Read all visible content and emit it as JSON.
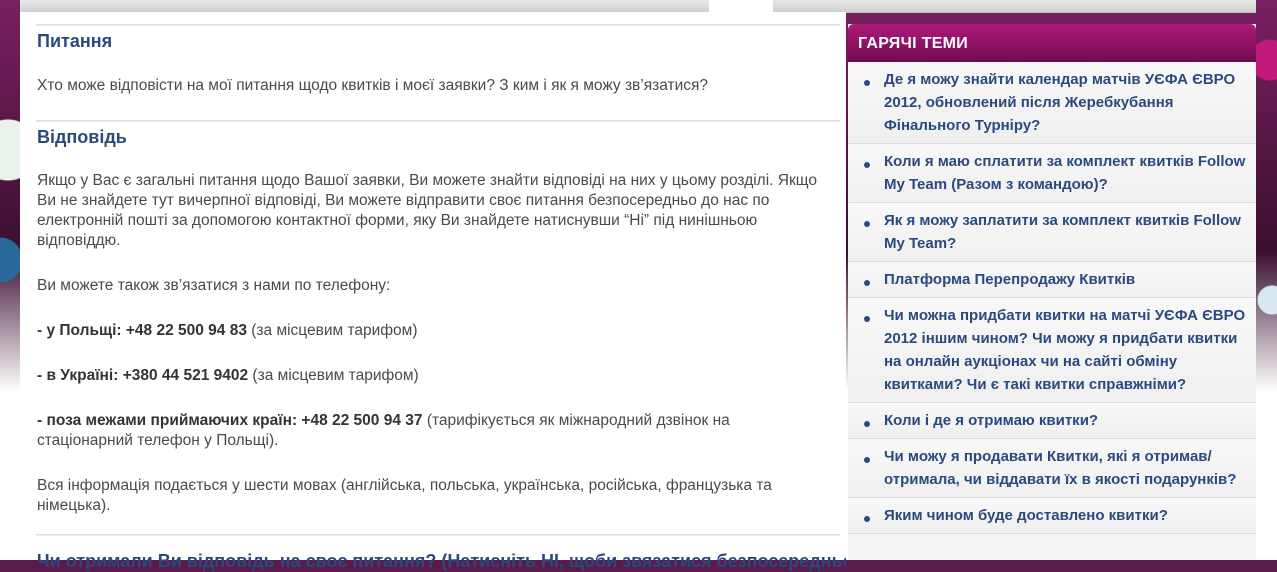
{
  "colors": {
    "heading": "#2a4a7f",
    "body_text": "#4a4a4a",
    "sidebar_header_top": "#b0197a",
    "sidebar_header_bottom": "#6f0c4c",
    "link": "#2a4a7f"
  },
  "question": {
    "heading": "Питання",
    "text": "Хто може відповісти на мої питання щодо квитків і моєї заявки? З ким і як я можу зв’язатися?"
  },
  "answer": {
    "heading": "Відповідь",
    "p1": "Якщо у Вас є загальні питання щодо Вашої заявки, Ви можете знайти відповіді на них у цьому розділі. Якщо Ви не знайдете тут вичерпної відповіді, Ви можете відправити своє питання безпосередньо до нас по електронній пошті за допомогою контактної форми, яку Ви знайдете натиснувши “Ні” під нинішньою відповіддю.",
    "p2": "Ви можете також зв’язатися з нами по телефону:",
    "phones": [
      {
        "label": "- у Польщі: +48 22 500 94 83",
        "note": " (за місцевим тарифом)"
      },
      {
        "label": "- в Україні: +380 44 521 9402",
        "note": " (за місцевим тарифом)"
      },
      {
        "label": "- поза межами приймаючих країн: +48 22 500 94 37",
        "note": " (тарифікується як міжнародний дзвінок на стаціонарний телефон у Польщі)."
      }
    ],
    "p3": "Вся інформація подається у шести мовах (англійська, польська, українська, російська, французька та німецька)."
  },
  "feedback": {
    "heading": "Чи отримали Ви відповідь на своє питання? (Натисніть НІ, щоби звязатися безпосередньо"
  },
  "sidebar": {
    "title": "ГАРЯЧІ ТЕМИ",
    "items": [
      {
        "label": "Де я можу знайти календар матчів УЄФА ЄВРО 2012, обновлений після Жеребкубання Фінального Турніру?"
      },
      {
        "label": "Коли я маю сплатити за комплект квитків Follow My Team (Разом з командою)?"
      },
      {
        "label": "Як я можу заплатити за комплект квитків Follow My Team?"
      },
      {
        "label": "Платформа Перепродажу Квитків"
      },
      {
        "label": "Чи можна придбати квитки на матчі УЄФА ЄВРО 2012 іншим чином? Чи можу я придбати квитки на онлайн аукціонах чи на сайті обміну квитками? Чи є такі квитки справжніми?"
      },
      {
        "label": "Коли і де я отримаю квитки?"
      },
      {
        "label": "Чи можу я продавати Квитки, які я отримав/отримала, чи віддавати їх в якості подарунків?"
      },
      {
        "label": "Яким чином буде доставлено квитки?"
      }
    ]
  }
}
